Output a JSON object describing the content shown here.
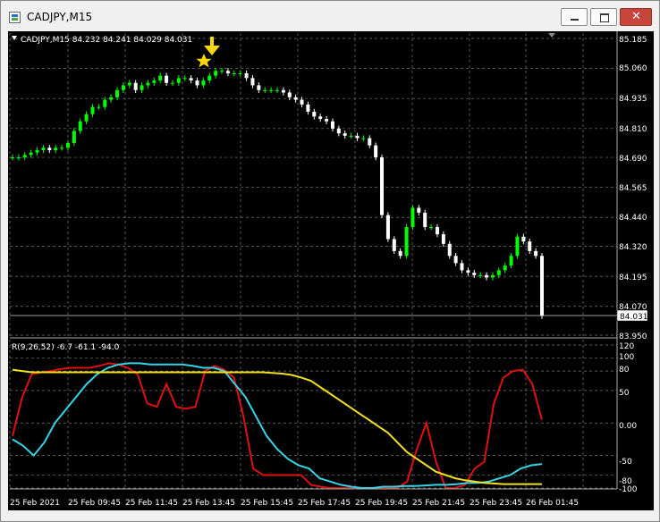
{
  "window": {
    "title": "CADJPY,M15"
  },
  "main_chart": {
    "header": "CADJPY,M15  84.232 84.241 84.029 84.031",
    "price_labels": [
      "85.185",
      "85.060",
      "84.935",
      "84.810",
      "84.690",
      "84.565",
      "84.440",
      "84.320",
      "84.195",
      "84.070",
      "83.950"
    ],
    "current_price": "84.031",
    "colors": {
      "background": "#000000",
      "grid": "#777777",
      "bull": "#00ff00",
      "bear": "#ffffff",
      "marker": "#ffd700"
    }
  },
  "indicator": {
    "header": "R(9,26,52) -6.7 -61.1 -94.0",
    "level_labels": [
      "120",
      "100",
      "80",
      "50",
      "0.00",
      "-50",
      "-80",
      "-100"
    ],
    "colors": {
      "fast": "#e01010",
      "medium": "#33d6e6",
      "slow": "#f2e21a"
    }
  },
  "time_labels": [
    "25 Feb 2021",
    "25 Feb 09:45",
    "25 Feb 11:45",
    "25 Feb 13:45",
    "25 Feb 15:45",
    "25 Feb 17:45",
    "25 Feb 19:45",
    "25 Feb 21:45",
    "25 Feb 23:45",
    "26 Feb 01:45"
  ],
  "chart_data": {
    "type": "line",
    "title": "CADJPY,M15",
    "candles_close": [
      84.69,
      84.69,
      84.7,
      84.71,
      84.72,
      84.73,
      84.72,
      84.73,
      84.73,
      84.75,
      84.8,
      84.84,
      84.87,
      84.9,
      84.9,
      84.93,
      84.94,
      84.97,
      84.99,
      85.0,
      84.97,
      84.99,
      85.0,
      85.01,
      85.03,
      85.0,
      85.0,
      85.02,
      85.02,
      85.01,
      84.99,
      85.01,
      85.03,
      85.05,
      85.05,
      85.04,
      85.04,
      85.04,
      85.02,
      84.99,
      84.97,
      84.97,
      84.97,
      84.97,
      84.96,
      84.94,
      84.93,
      84.91,
      84.88,
      84.86,
      84.85,
      84.84,
      84.81,
      84.79,
      84.78,
      84.78,
      84.77,
      84.77,
      84.74,
      84.69,
      84.45,
      84.35,
      84.3,
      84.28,
      84.4,
      84.48,
      84.46,
      84.4,
      84.4,
      84.37,
      84.33,
      84.28,
      84.25,
      84.22,
      84.21,
      84.2,
      84.2,
      84.19,
      84.2,
      84.22,
      84.24,
      84.28,
      84.36,
      84.34,
      84.3,
      84.28,
      84.03
    ],
    "oscillator": {
      "ylim": [
        -100,
        120
      ],
      "series": [
        {
          "values": [
            -20,
            40,
            75,
            78,
            80,
            83,
            85,
            85,
            85,
            88,
            92,
            90,
            85,
            75,
            30,
            25,
            60,
            25,
            22,
            25,
            80,
            88,
            82,
            70,
            10,
            -70,
            -80,
            -80,
            -80,
            -80,
            -80,
            -95,
            -98,
            -100,
            -100,
            -100,
            -100,
            -100,
            -100,
            -100,
            -100,
            -90,
            -40,
            0,
            -60,
            -100,
            -100,
            -95,
            -70,
            -60,
            30,
            70,
            80,
            82,
            60,
            5
          ]
        },
        {
          "values": [
            -25,
            -35,
            -50,
            -30,
            0,
            20,
            40,
            60,
            75,
            85,
            90,
            92,
            92,
            90,
            90,
            90,
            90,
            88,
            85,
            85,
            80,
            60,
            40,
            10,
            -20,
            -40,
            -55,
            -65,
            -70,
            -85,
            -90,
            -95,
            -98,
            -100,
            -100,
            -98,
            -98,
            -97,
            -97,
            -96,
            -95,
            -95,
            -94,
            -92,
            -92,
            -90,
            -85,
            -80,
            -70,
            -65,
            -63
          ]
        },
        {
          "values": [
            82,
            80,
            78,
            78,
            78,
            78,
            78,
            78,
            78,
            78,
            78,
            78,
            78,
            78,
            78,
            78,
            78,
            78,
            78,
            78,
            78,
            78,
            78,
            78,
            78,
            78,
            78,
            77,
            76,
            74,
            70,
            65,
            55,
            45,
            35,
            25,
            15,
            5,
            -5,
            -15,
            -30,
            -45,
            -55,
            -65,
            -75,
            -80,
            -85,
            -88,
            -90,
            -92,
            -93,
            -94,
            -94,
            -94,
            -94,
            -94
          ]
        }
      ]
    }
  }
}
